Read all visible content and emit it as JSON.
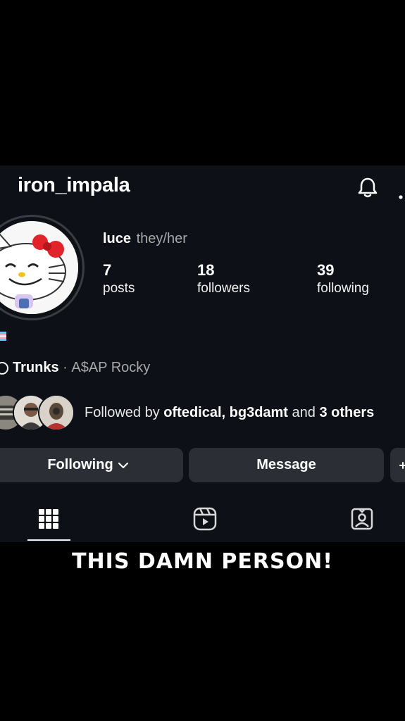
{
  "header": {
    "username": "iron_impala",
    "notifications_icon": "bell-icon",
    "more_icon": "more-vertical-icon"
  },
  "profile": {
    "display_name": "luce",
    "pronouns": "they/her",
    "stats": [
      {
        "value": "7",
        "label": "posts"
      },
      {
        "value": "18",
        "label": "followers"
      },
      {
        "value": "39",
        "label": "following"
      }
    ],
    "music": {
      "track": "Trunks",
      "separator": "·",
      "artist": "A$AP Rocky"
    },
    "followed_by": {
      "prefix": "Followed by ",
      "names": "oftedical, bg3damt",
      "middle": " and ",
      "others": "3 others"
    }
  },
  "buttons": {
    "following": "Following",
    "message": "Message"
  },
  "tabs": [
    {
      "icon": "grid-icon",
      "active": true
    },
    {
      "icon": "reels-icon",
      "active": false
    },
    {
      "icon": "tagged-icon",
      "active": false
    }
  ],
  "caption": "THIS DAMN PERSON!",
  "colors": {
    "background": "#0d1117",
    "button": "#2b2f35",
    "muted_text": "#a8a8a8"
  }
}
